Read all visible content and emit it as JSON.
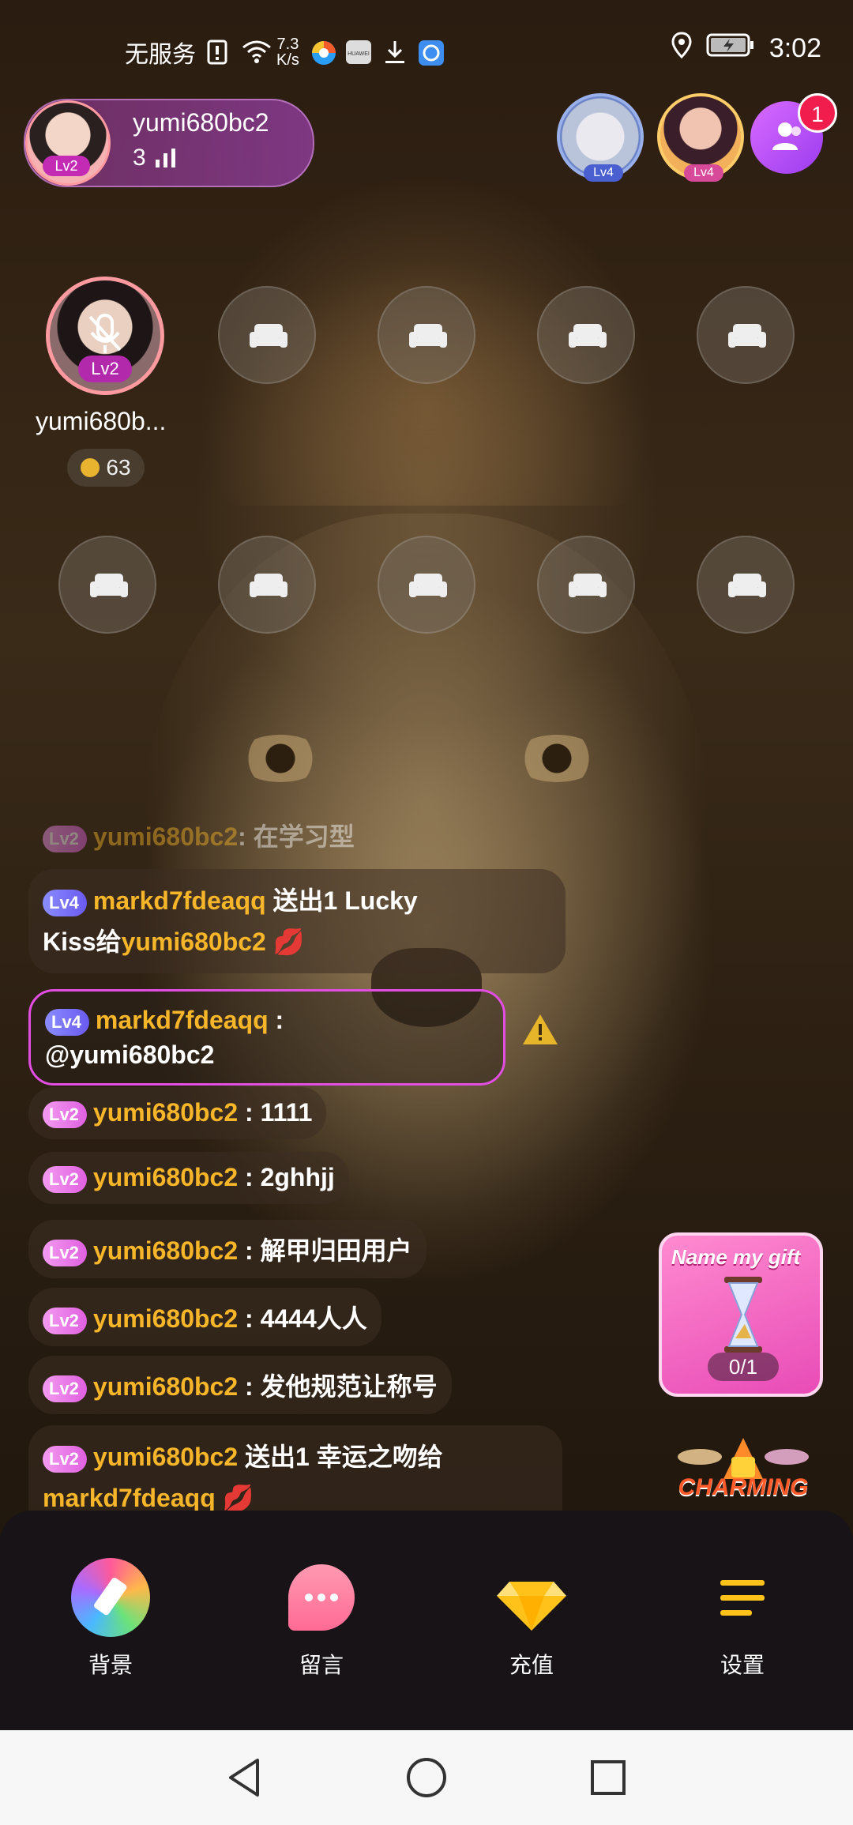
{
  "status_bar": {
    "carrier": "无服务",
    "speed_value": "7.3",
    "speed_unit": "K/s",
    "time": "3:02",
    "icons": [
      "sim-alert-icon",
      "wifi-icon",
      "browser-icon",
      "huawei-icon",
      "download-icon",
      "app-icon",
      "location-icon",
      "battery-icon"
    ],
    "huawei_label": "HUAWEI"
  },
  "host": {
    "name": "yumi680bc2",
    "level": "Lv2",
    "online_count": "3"
  },
  "top_right": {
    "avatar1_level": "Lv4",
    "avatar2_level": "Lv4",
    "notification_count": "1"
  },
  "seats": {
    "occupied": {
      "name": "yumi680b...",
      "level": "Lv2",
      "coins": "63"
    }
  },
  "chat": {
    "messages": [
      {
        "level": "Lv2",
        "user": "yumi680bc2",
        "text": ": 在学习型"
      },
      {
        "level": "Lv4",
        "user": "markd7fdeaqq",
        "text": " 送出1 Lucky",
        "line2_prefix": "Kiss给",
        "line2_user": "yumi680bc2"
      },
      {
        "level": "Lv4",
        "user": "markd7fdeaqq",
        "text": " :",
        "line2": "@yumi680bc2"
      },
      {
        "level": "Lv2",
        "user": "yumi680bc2",
        "text": " : 1111"
      },
      {
        "level": "Lv2",
        "user": "yumi680bc2",
        "text": " : 2ghhjj"
      },
      {
        "level": "Lv2",
        "user": "yumi680bc2",
        "text": " : 解甲归田用户"
      },
      {
        "level": "Lv2",
        "user": "yumi680bc2",
        "text": " : 4444人人"
      },
      {
        "level": "Lv2",
        "user": "yumi680bc2",
        "text": " : 发他规范让称号"
      },
      {
        "level": "Lv2",
        "user": "yumi680bc2",
        "text": " 送出1 幸运之吻给",
        "line2_user": "markd7fdeaqq"
      }
    ]
  },
  "gift_card": {
    "title": "Name my gift",
    "progress": "0/1"
  },
  "charming_label": "CHARMING",
  "toolbar": {
    "background_label": "背景",
    "message_label": "留言",
    "recharge_label": "充值",
    "settings_label": "设置"
  },
  "colors": {
    "accent": "#e24de2",
    "username": "#f7b62a",
    "panel": "#171316"
  }
}
